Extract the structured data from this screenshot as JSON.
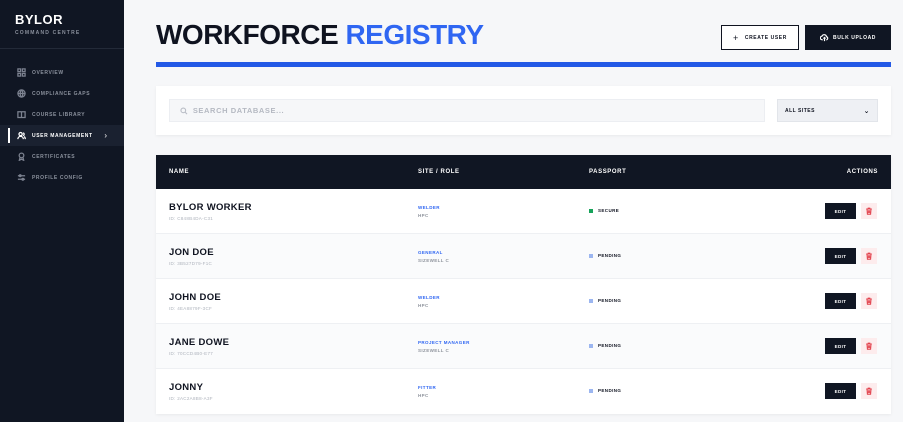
{
  "brand": {
    "title": "BYLOR",
    "subtitle": "COMMAND CENTRE"
  },
  "sidebar": {
    "items": [
      {
        "label": "OVERVIEW",
        "icon": "grid-icon",
        "active": false
      },
      {
        "label": "COMPLIANCE GAPS",
        "icon": "globe-icon",
        "active": false
      },
      {
        "label": "COURSE LIBRARY",
        "icon": "book-icon",
        "active": false
      },
      {
        "label": "USER MANAGEMENT",
        "icon": "users-icon",
        "active": true
      },
      {
        "label": "CERTIFICATES",
        "icon": "award-icon",
        "active": false
      },
      {
        "label": "PROFILE CONFIG",
        "icon": "sliders-icon",
        "active": false
      }
    ]
  },
  "header": {
    "title_part1": "WORKFORCE",
    "title_part2": "REGISTRY",
    "create_label": "CREATE USER",
    "bulk_label": "BULK UPLOAD"
  },
  "search": {
    "placeholder": "SEARCH DATABASE...",
    "value": ""
  },
  "filter": {
    "selected": "ALL SITES"
  },
  "table": {
    "headers": {
      "name": "NAME",
      "site_role": "SITE / ROLE",
      "passport": "PASSPORT",
      "actions": "ACTIONS"
    },
    "rows": [
      {
        "name": "BYLOR WORKER",
        "id": "ID: C848B4DA-C31",
        "role": "WELDER",
        "site": "HPC",
        "status": "SECURE",
        "status_color": "#17a35a",
        "edit": "EDIT"
      },
      {
        "name": "JON DOE",
        "id": "ID: 3B527D79-F1C",
        "role": "GENERAL",
        "site": "SIZEWELL C",
        "status": "PENDING",
        "status_color": "#9cb6f0",
        "edit": "EDIT"
      },
      {
        "name": "JOHN DOE",
        "id": "ID: 4EA8879F-3CF",
        "role": "WELDER",
        "site": "HPC",
        "status": "PENDING",
        "status_color": "#9cb6f0",
        "edit": "EDIT"
      },
      {
        "name": "JANE DOWE",
        "id": "ID: 70CCD4B0-E77",
        "role": "PROJECT MANAGER",
        "site": "SIZEWELL C",
        "status": "PENDING",
        "status_color": "#9cb6f0",
        "edit": "EDIT"
      },
      {
        "name": "JONNY",
        "id": "ID: 2AC2A8B8-A3F",
        "role": "FITTER",
        "site": "HPC",
        "status": "PENDING",
        "status_color": "#9cb6f0",
        "edit": "EDIT"
      }
    ]
  },
  "colors": {
    "accent": "#2f66f2",
    "dark": "#101623",
    "secure": "#17a35a",
    "pending": "#9cb6f0",
    "delete": "#e2404b"
  }
}
